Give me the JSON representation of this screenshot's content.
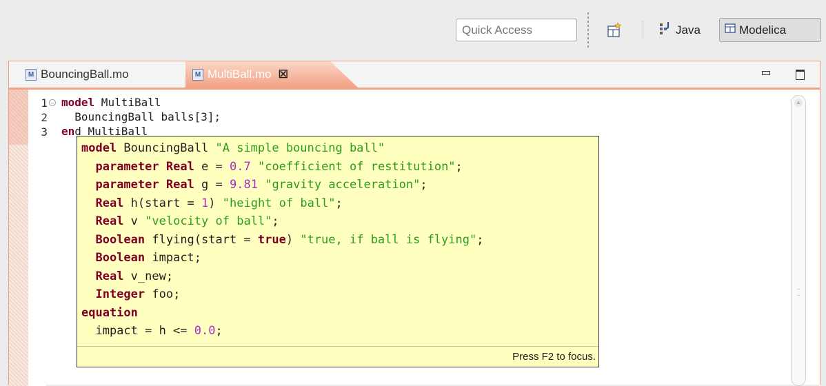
{
  "toolbar": {
    "quick_access_placeholder": "Quick Access",
    "perspectives": [
      {
        "label": "Java",
        "icon": "java-perspective-icon"
      },
      {
        "label": "Modelica",
        "icon": "modelica-perspective-icon",
        "active": true
      }
    ]
  },
  "tabs": [
    {
      "label": "BouncingBall.mo",
      "icon": "modelica-file-icon",
      "active": false
    },
    {
      "label": "MultiBall.mo",
      "icon": "modelica-file-icon",
      "active": true
    }
  ],
  "editor": {
    "line_numbers": [
      "1",
      "2",
      "3"
    ],
    "lines": {
      "l1_kw": "model",
      "l1_rest": " MultiBall",
      "l2": "  BouncingBall balls[3];",
      "l3_kw": "en",
      "l3_rest": "d MultiBall"
    }
  },
  "hover": {
    "line1": {
      "kw": "model",
      "name": " BouncingBall ",
      "str": "\"A simple bouncing ball\""
    },
    "line2": {
      "kw1": "parameter",
      "kw2": "Real",
      "rest": " e = ",
      "num": "0.7",
      "sp": " ",
      "str": "\"coefficient of restitution\"",
      "end": ";"
    },
    "line3": {
      "kw1": "parameter",
      "kw2": "Real",
      "rest": " g = ",
      "num": "9.81",
      "sp": " ",
      "str": "\"gravity acceleration\"",
      "end": ";"
    },
    "line4": {
      "kw": "Real",
      "a": " h(start = ",
      "num": "1",
      "b": ") ",
      "str": "\"height of ball\"",
      "end": ";"
    },
    "line5": {
      "kw": "Real",
      "a": " v ",
      "str": "\"velocity of ball\"",
      "end": ";"
    },
    "line6": {
      "kw": "Boolean",
      "a": " flying(start = ",
      "kw2": "true",
      "b": ") ",
      "str": "\"true, if ball is flying\"",
      "end": ";"
    },
    "line7": {
      "kw": "Boolean",
      "rest": " impact;"
    },
    "line8": {
      "kw": "Real",
      "rest": " v_new;"
    },
    "line9": {
      "kw": "Integer",
      "rest": " foo;"
    },
    "line10": {
      "kw": "equation"
    },
    "line11": {
      "a": "  impact = h <= ",
      "num": "0.0",
      "end": ";"
    },
    "footer": "Press F2 to focus."
  },
  "colors": {
    "keyword": "#7f0025",
    "string": "#2a9d1e",
    "number": "#a72ec4",
    "popup_bg": "#ffffc0",
    "active_tab": "#f2a285"
  }
}
